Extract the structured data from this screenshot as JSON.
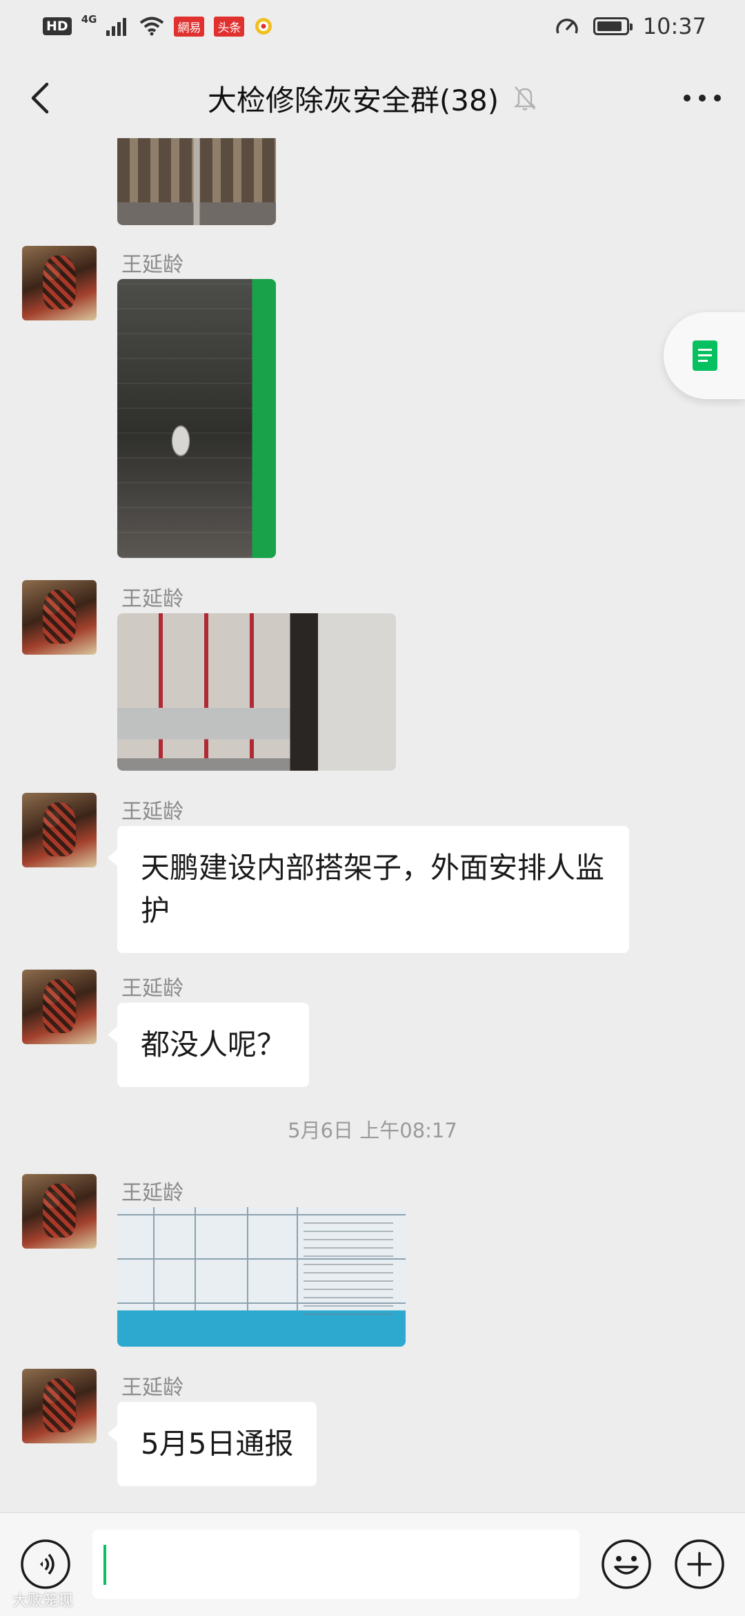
{
  "status_bar": {
    "hd": "HD",
    "network": "4G",
    "badge_1": "網易",
    "badge_2": "头条",
    "time": "10:37"
  },
  "header": {
    "title": "大检修除灰安全群(38)"
  },
  "messages": [
    {
      "type": "image",
      "sender": "",
      "image": "scaffold-photo"
    },
    {
      "type": "image",
      "sender": "王延龄",
      "image": "dark-shaft-photo"
    },
    {
      "type": "image",
      "sender": "王延龄",
      "image": "scaffold-platform-photo"
    },
    {
      "type": "text",
      "sender": "王延龄",
      "text": "天鹏建设内部搭架子，外面安排人监护"
    },
    {
      "type": "text",
      "sender": "王延龄",
      "text": "都没人呢？"
    },
    {
      "type": "time",
      "text": "5月6日 上午08:17"
    },
    {
      "type": "image",
      "sender": "王延龄",
      "image": "notice-table-photo"
    },
    {
      "type": "text",
      "sender": "王延龄",
      "text": "5月5日通报"
    }
  ],
  "input_bar": {
    "value": ""
  },
  "watermark": "大败笼现",
  "icons": {
    "back": "back-chevron-icon",
    "mute": "bell-muted-icon",
    "more": "more-dots-icon",
    "side": "note-icon",
    "voice": "voice-icon",
    "emoji": "emoji-icon",
    "plus": "plus-icon"
  },
  "colors": {
    "background": "#ededed",
    "bubble": "#ffffff",
    "accent": "#07c160"
  }
}
